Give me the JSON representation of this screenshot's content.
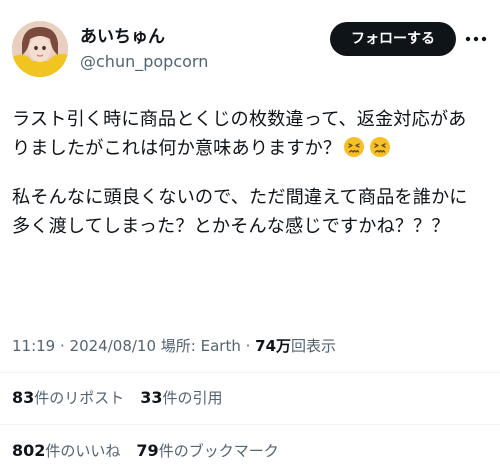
{
  "user": {
    "display_name": "あいちゅん",
    "handle": "@chun_popcorn"
  },
  "follow_button_label": "フォローする",
  "more_icon": "ellipsis-icon",
  "tweet": {
    "paragraph1_text": "ラスト引く時に商品とくじの枚数違って、返金対応がありましたがこれは何か意味ありますか？",
    "paragraph1_emoji": "confounded-face-emoji",
    "paragraph2_text": "私そんなに頭良くないので、ただ間違えて商品を誰かに多く渡してしまった？とかそんな感じですかね？？？"
  },
  "meta": {
    "time": "11:19",
    "separator": " · ",
    "date": "2024/08/10",
    "location_label": "場所: ",
    "location": "Earth",
    "views_count": "74万",
    "views_label": "回表示"
  },
  "stats": {
    "reposts_count": "83",
    "reposts_label": "件のリポスト",
    "quotes_count": "33",
    "quotes_label": "件の引用",
    "likes_count": "802",
    "likes_label": "件のいいね",
    "bookmarks_count": "79",
    "bookmarks_label": "件のブックマーク"
  },
  "colors": {
    "text": "#0f1419",
    "secondary": "#536471",
    "divider": "#eff3f4",
    "button_bg": "#0f1419",
    "emoji_yellow": "#f6c026"
  }
}
